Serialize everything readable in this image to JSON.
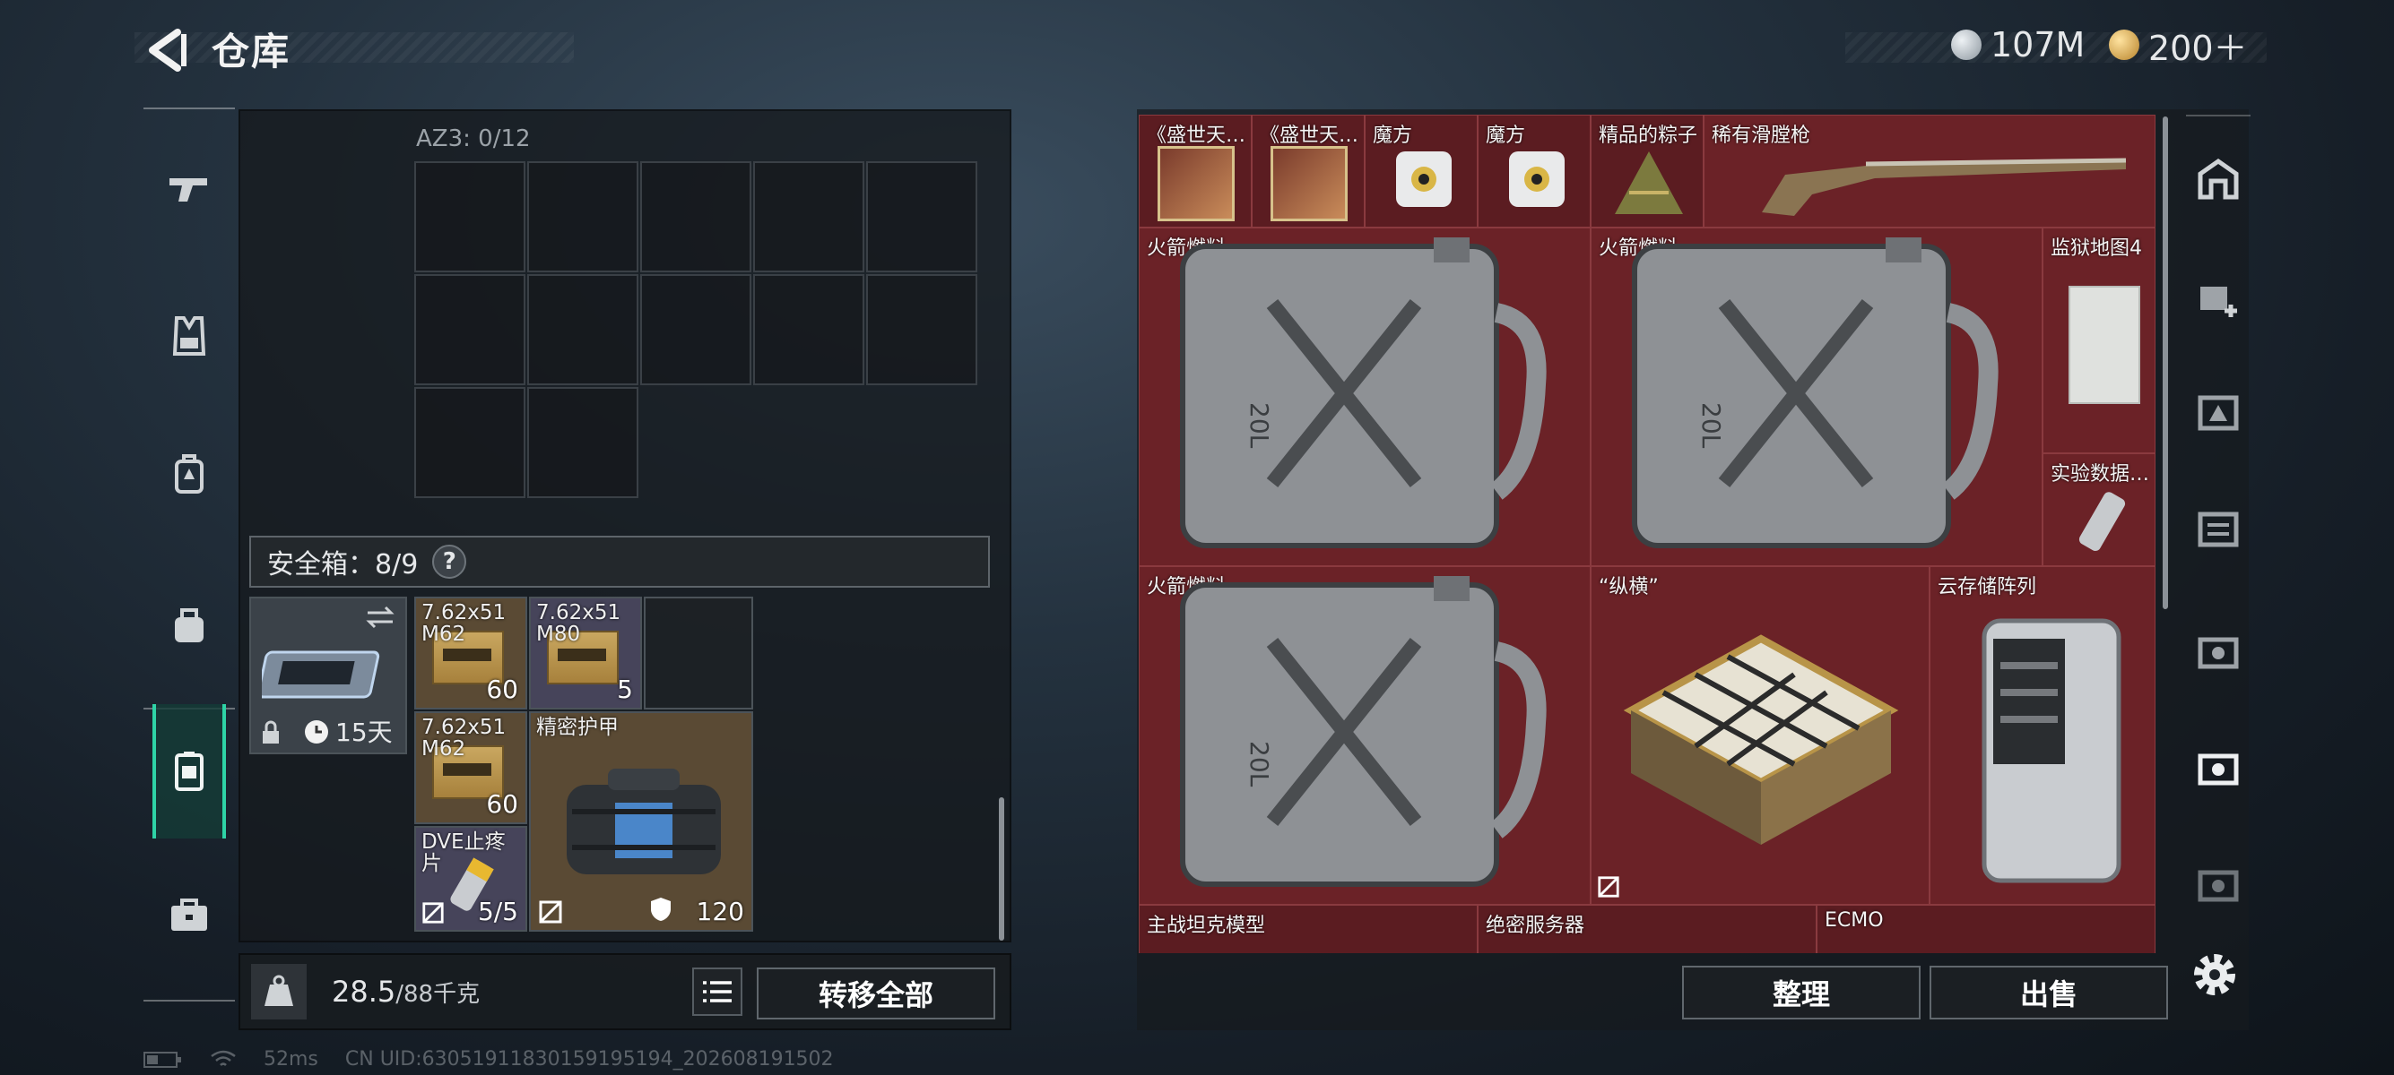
{
  "header": {
    "title": "仓库"
  },
  "currency": [
    {
      "icon": "silver-coin-icon",
      "value": "107M",
      "color": "#b9c2c9"
    },
    {
      "icon": "gold-coin-icon",
      "value": "200＋",
      "color": "#d9a642"
    }
  ],
  "left_nav": [
    {
      "name": "weapon-nav-icon"
    },
    {
      "name": "vest-nav-icon"
    },
    {
      "name": "backpack-nav-icon"
    },
    {
      "name": "bag-nav-icon"
    },
    {
      "name": "safe-box-nav-icon",
      "active": true
    },
    {
      "name": "briefcase-nav-icon"
    }
  ],
  "container": {
    "label": "AZ3: 0/12"
  },
  "safe_box": {
    "title": "安全箱：8/9",
    "help": "?",
    "timer": "15天",
    "items": [
      {
        "label": "7.62x51 M62",
        "count": "60"
      },
      {
        "label": "7.62x51 M80",
        "count": "5"
      },
      {
        "label": "7.62x51 M62",
        "count": "60"
      },
      {
        "label": "精密护甲",
        "count": "120"
      },
      {
        "label": "DVE止疼片",
        "count": "5/5"
      }
    ]
  },
  "weight": {
    "current": "28.5",
    "max": "/88千克"
  },
  "buttons": {
    "transfer_all": "转移全部",
    "organize": "整理",
    "sell": "出售"
  },
  "stash_items": [
    {
      "label": "《盛世天…"
    },
    {
      "label": "《盛世天…"
    },
    {
      "label": "魔方"
    },
    {
      "label": "魔方"
    },
    {
      "label": "精品的粽子"
    },
    {
      "label": "稀有滑膛枪"
    },
    {
      "label": "火箭燃料"
    },
    {
      "label": "火箭燃料"
    },
    {
      "label": "监狱地图4"
    },
    {
      "label": "实验数据…"
    },
    {
      "label": "火箭燃料"
    },
    {
      "label": "“纵横”"
    },
    {
      "label": "云存储阵列"
    },
    {
      "label": "主战坦克模型"
    },
    {
      "label": "绝密服务器"
    },
    {
      "label": "ECMO"
    }
  ],
  "fuel_can_text": "20L",
  "footer": {
    "ping": "52ms",
    "uid": "CN UID:6305191183015919519​4_202608191502"
  },
  "colors": {
    "stash_bg": "#6b2227",
    "accent": "#2ed3a6",
    "ammo_bg": "#5a4a34"
  }
}
